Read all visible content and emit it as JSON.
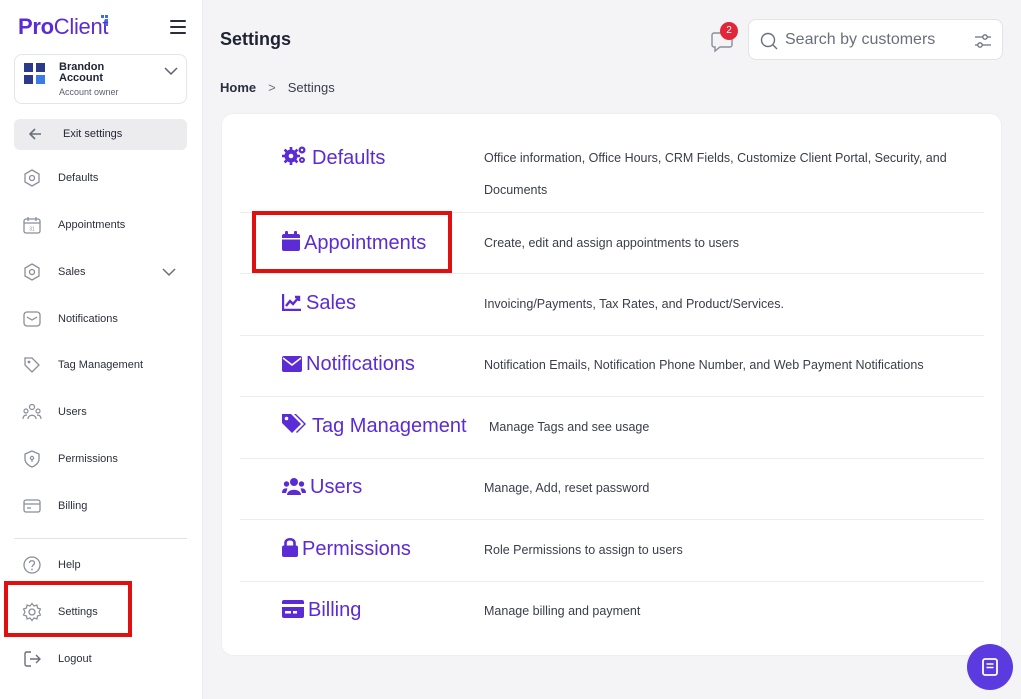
{
  "app": {
    "logo_pro": "Pro",
    "logo_client": "Client"
  },
  "account": {
    "name": "Brandon Account",
    "role": "Account owner"
  },
  "sidebar": {
    "exit_label": "Exit settings",
    "items": [
      {
        "label": "Defaults",
        "icon": "hexagon-icon"
      },
      {
        "label": "Appointments",
        "icon": "calendar-icon"
      },
      {
        "label": "Sales",
        "icon": "hexagon-icon"
      },
      {
        "label": "Notifications",
        "icon": "mail-icon"
      },
      {
        "label": "Tag Management",
        "icon": "tag-icon"
      },
      {
        "label": "Users",
        "icon": "users-icon"
      },
      {
        "label": "Permissions",
        "icon": "shield-icon"
      },
      {
        "label": "Billing",
        "icon": "card-icon"
      }
    ],
    "bottom_items": [
      {
        "label": "Help",
        "icon": "help-icon"
      },
      {
        "label": "Settings",
        "icon": "gear-icon"
      },
      {
        "label": "Logout",
        "icon": "logout-icon"
      }
    ]
  },
  "header": {
    "title": "Settings",
    "notification_count": "2",
    "search_placeholder": "Search by customers"
  },
  "breadcrumb": {
    "home": "Home",
    "separator": ">",
    "current": "Settings"
  },
  "settings": [
    {
      "title": "Defaults",
      "icon": "gears-icon",
      "description": "Office information, Office Hours, CRM Fields, Customize Client Portal, Security, and Documents"
    },
    {
      "title": "Appointments",
      "icon": "calendar-icon",
      "description": "Create, edit and assign appointments to users"
    },
    {
      "title": "Sales",
      "icon": "chart-line-icon",
      "description": "Invoicing/Payments, Tax Rates, and Product/Services."
    },
    {
      "title": "Notifications",
      "icon": "envelope-icon",
      "description": "Notification Emails, Notification Phone Number, and Web Payment Notifications"
    },
    {
      "title": "Tag Management",
      "icon": "tags-icon",
      "description": "Manage Tags and see usage"
    },
    {
      "title": "Users",
      "icon": "users-icon",
      "description": "Manage, Add, reset password"
    },
    {
      "title": "Permissions",
      "icon": "lock-icon",
      "description": "Role Permissions to assign to users"
    },
    {
      "title": "Billing",
      "icon": "credit-card-icon",
      "description": "Manage billing and payment"
    }
  ],
  "colors": {
    "accent": "#5b2bd6",
    "highlight": "#e01010",
    "badge": "#e1263a"
  }
}
